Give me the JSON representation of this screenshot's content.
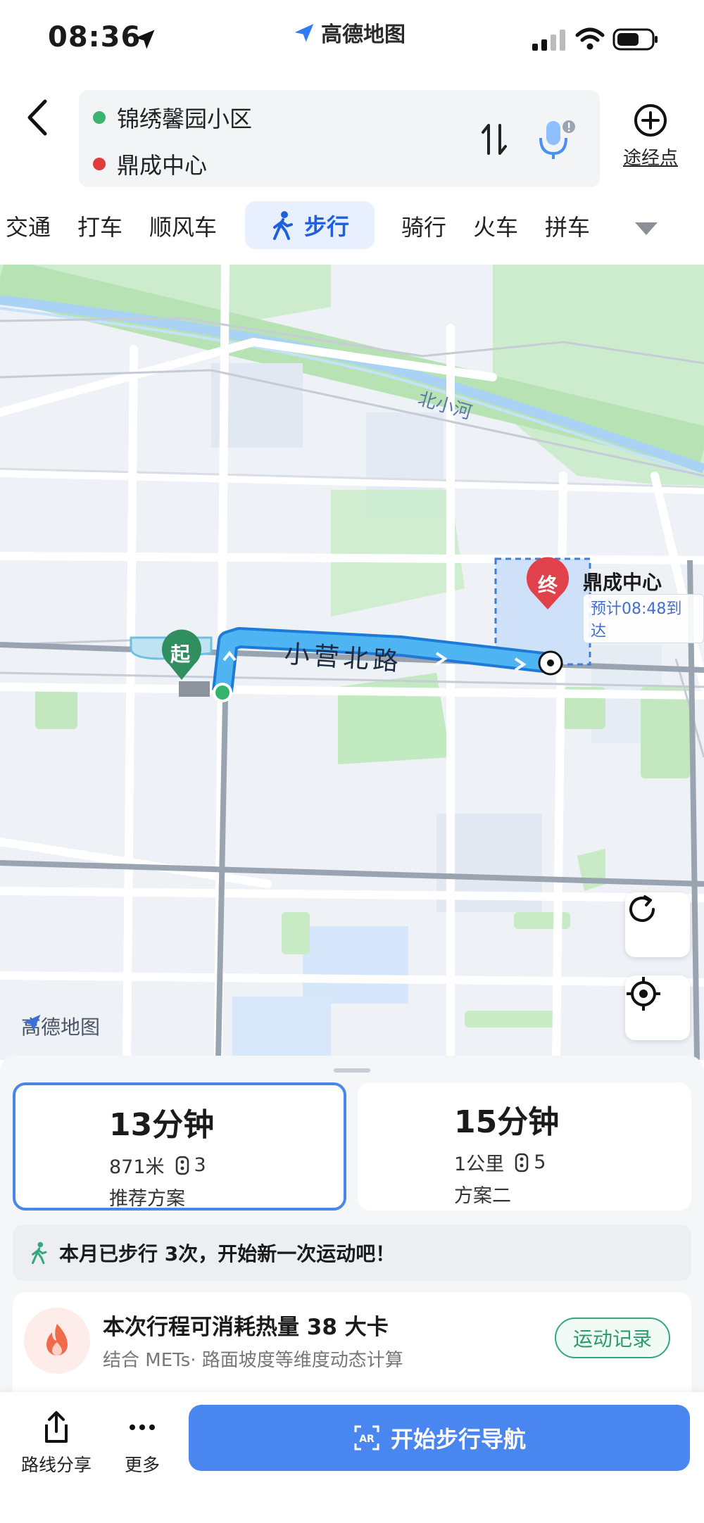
{
  "status_bar": {
    "time": "08:36",
    "app_name": "高德地图"
  },
  "route": {
    "origin": "锦绣馨园小区",
    "destination": "鼎成中心",
    "waypoint_label": "途经点",
    "origin_dot_color": "#3cb371",
    "destination_dot_color": "#e23b3b"
  },
  "modes": {
    "tabs": [
      "交通",
      "打车",
      "顺风车",
      "步行",
      "骑行",
      "火车",
      "拼车"
    ],
    "active": "步行"
  },
  "map": {
    "destination_name": "鼎成中心",
    "eta": "预计08:48到达",
    "road_label": "小营北路",
    "river_label": "北小河",
    "start_marker": "起",
    "end_marker": "终",
    "watermark": "高德地图",
    "route_color": "#4a9be8"
  },
  "plans": [
    {
      "time": "13分钟",
      "distance": "871米",
      "lights": "3",
      "name": "推荐方案",
      "selected": true
    },
    {
      "time": "15分钟",
      "distance": "1公里",
      "lights": "5",
      "name": "方案二",
      "selected": false
    }
  ],
  "walk_banner": "本月已步行 3次，开始新一次运动吧！",
  "calorie": {
    "title": "本次行程可消耗热量 38 大卡",
    "subtitle": "结合 METs· 路面坡度等维度动态计算",
    "record_button": "运动记录"
  },
  "bottom_bar": {
    "share_label": "路线分享",
    "more_label": "更多",
    "start_nav_label": "开始步行导航",
    "ar_badge": "AR"
  },
  "colors": {
    "accent": "#4a86f0",
    "active_tab_text": "#1d5fe0",
    "record_green": "#2e9a6f"
  }
}
